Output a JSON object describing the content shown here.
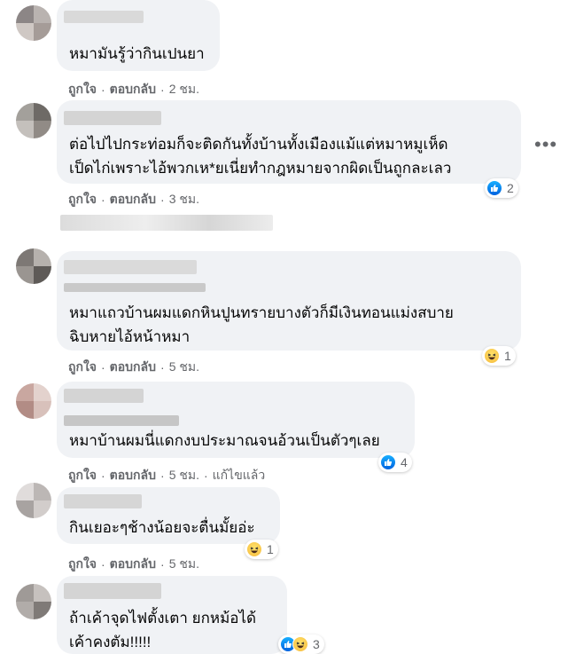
{
  "actions": {
    "like": "ถูกใจ",
    "reply": "ตอบกลับ",
    "separator": "·"
  },
  "more_icon": "•••",
  "comments": [
    {
      "lines": [
        "หมามันรู้ว่ากินเปนยา"
      ],
      "time": "2 ชม.",
      "reaction": null
    },
    {
      "lines": [
        "ต่อไปไปกระท่อมก็จะติดกันทั้งบ้านทั้งเมืองแม้แต่หมาหมูเห็ด",
        "เป็ดไก่เพราะไอ้พวกเห*ยเนี่ยทำกฎหมายจากผิดเป็นถูกละเลว"
      ],
      "time": "3 ชม.",
      "reaction": {
        "icons": [
          "like-icon"
        ],
        "count": "2"
      }
    },
    {
      "lines": [
        "หมาแถวบ้านผมแดกหินปูนทรายบางตัวก็มีเงินทอนแม่งสบาย",
        "ฉิบหายไอ้หน้าหมา"
      ],
      "time": "5 ชม.",
      "reaction": {
        "icons": [
          "haha-icon"
        ],
        "count": "1"
      }
    },
    {
      "lines": [
        "หมาบ้านผมนี่แดกงบประมาณจนอ้วนเป็นตัวๆเลย"
      ],
      "time": "5 ชม.",
      "edited": "แก้ไขแล้ว",
      "reaction": {
        "icons": [
          "like-icon"
        ],
        "count": "4"
      }
    },
    {
      "lines": [
        "กินเยอะๆช้างน้อยจะตื่นมั้ยอ่ะ"
      ],
      "time": "5 ชม.",
      "reaction": {
        "icons": [
          "haha-icon"
        ],
        "count": "1"
      }
    },
    {
      "lines": [
        "ถ้าเค้าจุดไฟตั้งเตา ยกหม้อได้",
        "เค้าคงตัม!!!!!"
      ],
      "time": "",
      "reaction": {
        "icons": [
          "like-icon",
          "haha-icon"
        ],
        "count": "3"
      }
    }
  ],
  "colors": {
    "bubble": "#f0f2f5",
    "like": "#1877f2",
    "haha": "#f7b125",
    "meta": "#65676b"
  }
}
